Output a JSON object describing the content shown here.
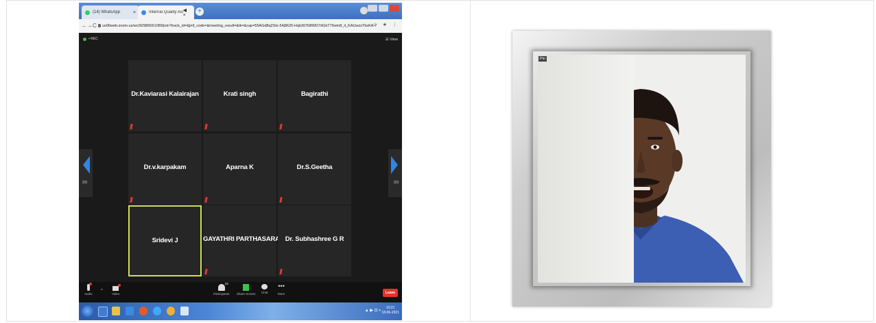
{
  "browser": {
    "tabs": [
      {
        "label": "(14) WhatsApp",
        "close": "×",
        "icon": "whatsapp-icon",
        "color": "#25d366"
      },
      {
        "label": "Internal Quality Assurance Ce",
        "close": "◀ ×",
        "icon": "zoom-icon",
        "color": "#2d8cff"
      }
    ],
    "new_tab": "+",
    "url": "us06web.zoom.us/wc/92986561089/join?track_id=&jmf_code=&meeting_result=&tk=&cap=55AGd8q2Sts-54j8625-Hqb307bBWD7dGkT79wm8_it_KAUwzsTbsKA-7rhmL...",
    "nav": [
      "←",
      "→",
      "C"
    ],
    "addr_icons": "☆ ★ ⋮"
  },
  "meeting": {
    "rec_label": "• REC",
    "view_label": "☰ View",
    "page_left": "2/3",
    "page_right": "2/3",
    "participants": [
      "Dr.Kaviarasi Kalairajan",
      "Krati singh",
      "Bagirathi",
      "Dr.v.karpakam",
      "Aparna K",
      "Dr.S.Geetha",
      "Sridevi J",
      "GAYATHRI PARTHASARATHY",
      "Dr. Subhashree G R"
    ],
    "toolbar": {
      "audio": "Audio",
      "video": "Video",
      "participants": "Participants",
      "participants_count": "24",
      "share": "Share Screen",
      "chat": "Chat",
      "more": "More",
      "more_glyph": "•••",
      "caret": "^",
      "leave": "Leave"
    }
  },
  "taskbar": {
    "tray": "▲ ▶ ⊡ ◐",
    "time": "10:21",
    "date": "18-06-2021"
  },
  "video": {
    "pin_label": "Pin"
  }
}
